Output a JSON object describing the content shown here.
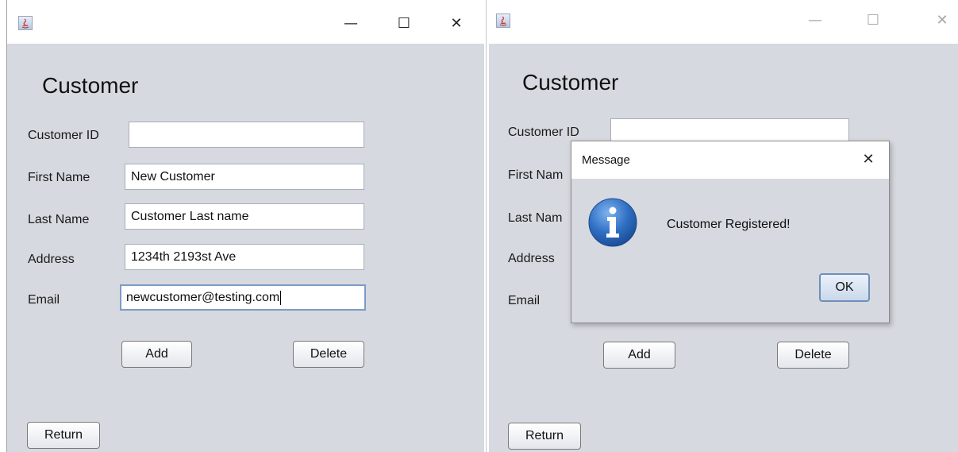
{
  "left_window": {
    "heading": "Customer",
    "fields": [
      {
        "label": "Customer ID",
        "value": ""
      },
      {
        "label": "First Name",
        "value": "New Customer"
      },
      {
        "label": "Last Name",
        "value": "Customer Last name"
      },
      {
        "label": "Address",
        "value": "1234th 2193st Ave"
      },
      {
        "label": "Email",
        "value": "newcustomer@testing.com"
      }
    ],
    "add_label": "Add",
    "delete_label": "Delete",
    "return_label": "Return"
  },
  "right_window": {
    "heading": "Customer",
    "labels": [
      "Customer ID",
      "First Nam",
      "Last Nam",
      "Address",
      "Email"
    ],
    "add_label": "Add",
    "delete_label": "Delete",
    "return_label": "Return"
  },
  "dialog": {
    "title": "Message",
    "message": "Customer Registered!",
    "ok_label": "OK",
    "icon": "info-icon"
  },
  "titlebar_glyphs": {
    "minimize": "—",
    "maximize": "☐",
    "close": "✕"
  },
  "colors": {
    "window_bg": "#d6d9df",
    "info_blue": "#2f6fc4",
    "focus_border": "#7d9bc7"
  }
}
